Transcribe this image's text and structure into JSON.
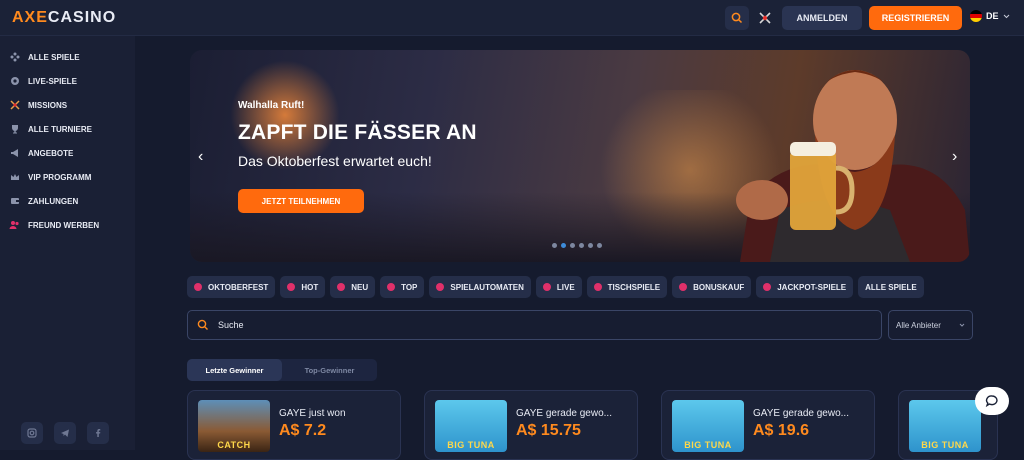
{
  "header": {
    "logo_axe": "AXE",
    "logo_casino": "CASINO",
    "login_label": "ANMELDEN",
    "register_label": "REGISTRIEREN",
    "language": "DE"
  },
  "sidebar": {
    "items": [
      {
        "label": "ALLE SPIELE",
        "icon": "grid-icon"
      },
      {
        "label": "LIVE-SPIELE",
        "icon": "live-icon"
      },
      {
        "label": "MISSIONS",
        "icon": "crossed-axes-icon"
      },
      {
        "label": "ALLE TURNIERE",
        "icon": "trophy-icon"
      },
      {
        "label": "ANGEBOTE",
        "icon": "megaphone-icon"
      },
      {
        "label": "VIP PROGRAMM",
        "icon": "crown-icon"
      },
      {
        "label": "ZAHLUNGEN",
        "icon": "wallet-icon"
      },
      {
        "label": "FREUND WERBEN",
        "icon": "users-icon"
      }
    ]
  },
  "banner": {
    "kicker": "Walhalla Ruft!",
    "title": "ZAPFT DIE FÄSSER AN",
    "subtitle": "Das Oktoberfest erwartet euch!",
    "cta": "JETZT TEILNEHMEN"
  },
  "categories": [
    "OKTOBERFEST",
    "HOT",
    "NEU",
    "TOP",
    "SPIELAUTOMATEN",
    "LIVE",
    "TISCHSPIELE",
    "BONUSKAUF",
    "JACKPOT-SPIELE",
    "ALLE SPIELE"
  ],
  "search": {
    "placeholder": "Suche",
    "provider": "Alle Anbieter"
  },
  "winner_tabs": [
    "Letzte Gewinner",
    "Top-Gewinner"
  ],
  "winners": [
    {
      "name": "GAYE just won",
      "amount": "A$ 7.2",
      "game_text": "CATCH"
    },
    {
      "name": "GAYE gerade gewo...",
      "amount": "A$ 15.75",
      "game_text": "BIG TUNA"
    },
    {
      "name": "GAYE gerade gewo...",
      "amount": "A$ 19.6",
      "game_text": "BIG TUNA"
    },
    {
      "game_text": "BIG TUNA"
    }
  ],
  "colors": {
    "accent": "#ff6a0d",
    "background": "#151b2e",
    "panel": "#1b2238"
  }
}
